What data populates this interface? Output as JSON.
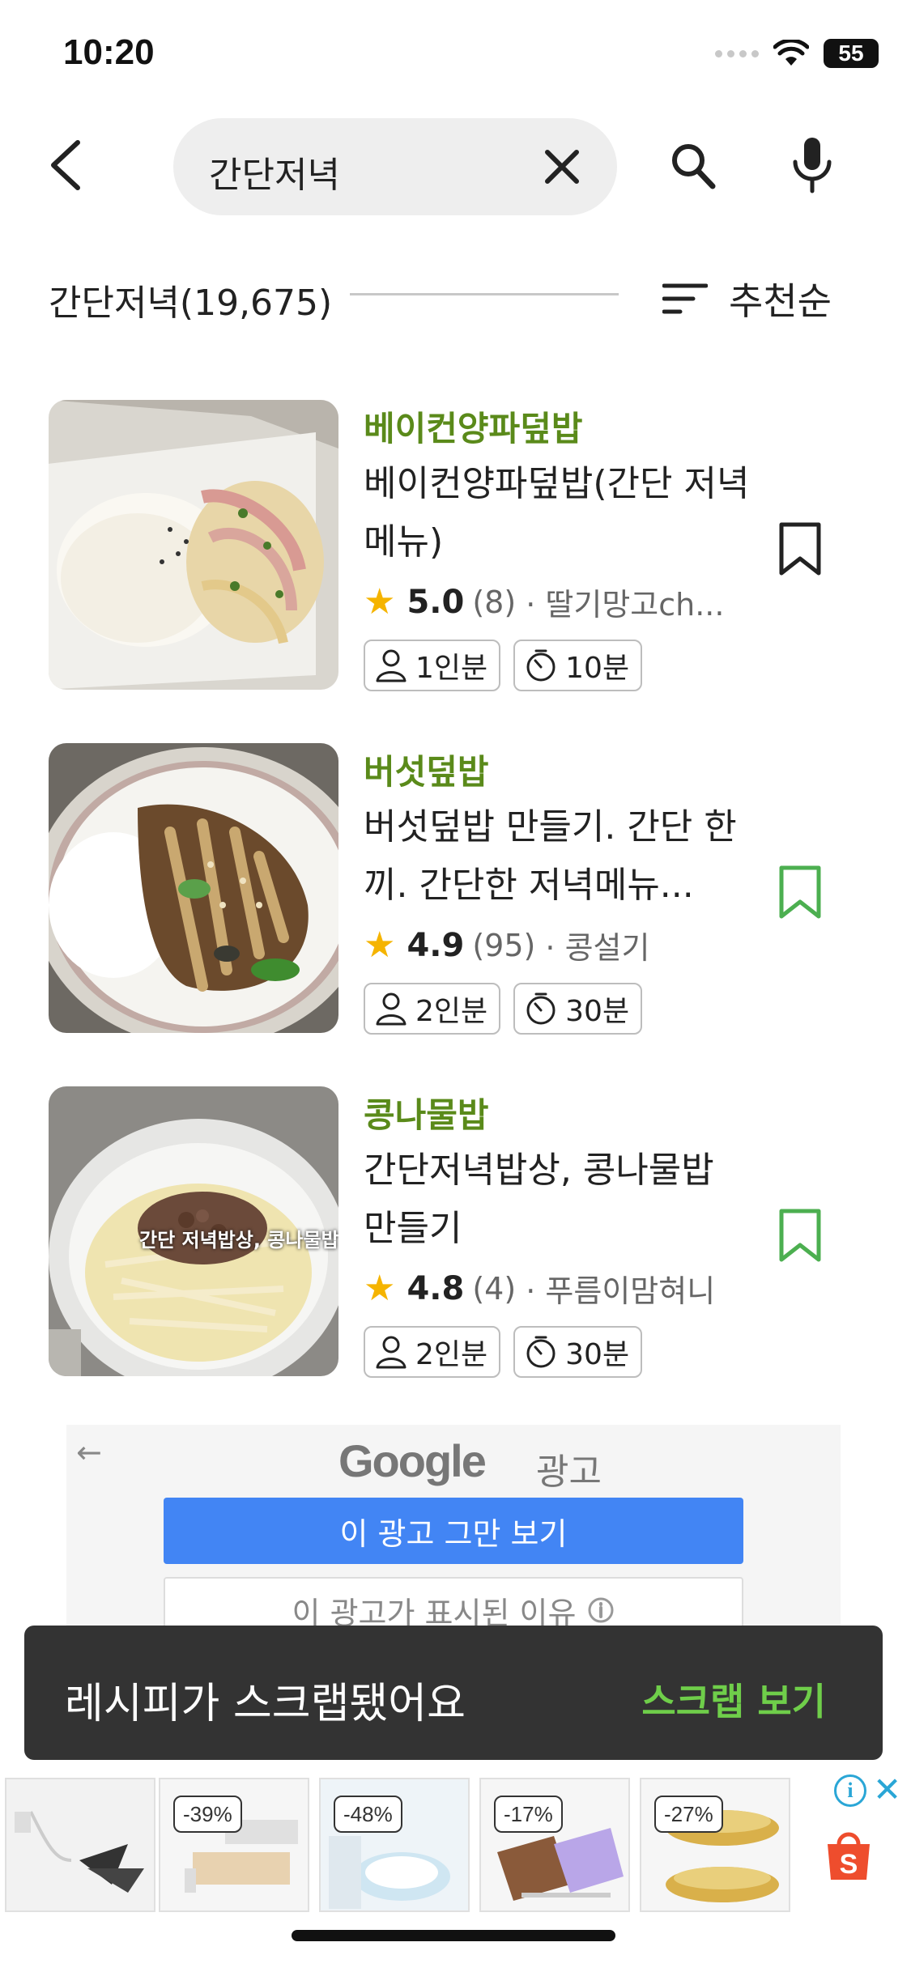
{
  "status_bar": {
    "time": "10:20",
    "battery": "55"
  },
  "search": {
    "query": "간단저녁"
  },
  "results": {
    "title": "간단저녁(19,675)",
    "sort_label": "추천순"
  },
  "recipes": [
    {
      "category": "베이컨양파덮밥",
      "title": "베이컨양파덮밥(간단 저녁메뉴)",
      "rating": "5.0",
      "count": "(8)",
      "author": "· 딸기망고ch...",
      "servings": "1인분",
      "time": "10분",
      "bookmark_color": "#222222"
    },
    {
      "category": "버섯덮밥",
      "title": "버섯덮밥 만들기. 간단 한끼. 간단한 저녁메뉴...",
      "rating": "4.9",
      "count": "(95)",
      "author": "· 콩설기",
      "servings": "2인분",
      "time": "30분",
      "bookmark_color": "#4caf50"
    },
    {
      "category": "콩나물밥",
      "title": "간단저녁밥상, 콩나물밥 만들기",
      "rating": "4.8",
      "count": "(4)",
      "author": "· 푸름이맘혀니",
      "servings": "2인분",
      "time": "30분",
      "bookmark_color": "#4caf50",
      "image_overlay": "간단 저녁밥상, 콩나물밥"
    }
  ],
  "ad": {
    "logo": "Google",
    "logo_sub": "광고",
    "stop_button": "이 광고 그만 보기",
    "why_button": "이 광고가 표시된 이유"
  },
  "toast": {
    "message": "레시피가 스크랩됐어요",
    "action": "스크랩 보기"
  },
  "bottom_ad": {
    "products": [
      {
        "discount": ""
      },
      {
        "discount": "-39%"
      },
      {
        "discount": "-48%"
      },
      {
        "discount": "-17%"
      },
      {
        "discount": "-27%"
      }
    ],
    "adchoice": "i",
    "close": "✕"
  },
  "colors": {
    "category_green": "#5a8a1a",
    "toast_action": "#6fce4a",
    "ad_blue": "#4285f4",
    "star": "#f5b400"
  }
}
